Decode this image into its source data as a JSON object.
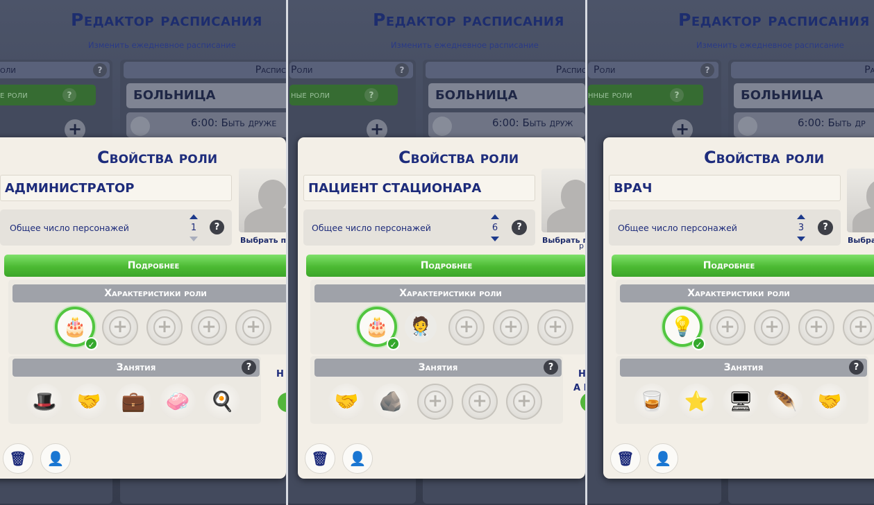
{
  "schedule_editor": {
    "title": "Редактор расписания",
    "subtitle": "Изменить ежедневное расписание",
    "roles_header": "Роли",
    "roles_header_partial": "оли",
    "schedule_header_partial": "Распис",
    "schedule_header_partial2": "Распис",
    "schedule_header_partial3": "Расп",
    "green_role_partial": "е роли",
    "green_role_partial2": "ные роли",
    "green_role_partial3": "нные роли",
    "venue": "БОЛЬНИЦА",
    "entry_partial": "6:00: Быть друже",
    "entry_partial2": "6:00: Быть друж",
    "entry_partial3": "6:00: Быть др",
    "help": "?",
    "add": "+"
  },
  "dialog_common": {
    "title": "Свойства роли",
    "count_label": "Общее число персонажей",
    "pick_label_1": "Выбрать пе",
    "pick_label_2": "Выбрать п",
    "pick_label_3": "Выбра",
    "details": "Подробнее",
    "traits_header": "Характеристики роли",
    "activities_header": "Занятия",
    "help": "?",
    "plus": "+",
    "check": "✓"
  },
  "roles": [
    {
      "name": "АДМИНИСТРАТОР",
      "count": "1",
      "trait_icon": "cake-icon",
      "activities": [
        "hat-icon",
        "handshake-icon",
        "briefcase-icon",
        "soap-icon",
        "frying-pan-icon"
      ],
      "side_text_1": "Н"
    },
    {
      "name": "ПАЦИЕНТ СТАЦИОНАРА",
      "count": "6",
      "trait_icon": "cake-icon",
      "extra_trait_icon": "doctor-portrait-icon",
      "activities": [
        "handshake-icon",
        "rock-icon"
      ],
      "side_text_1": "Н",
      "side_text_2": "А Р",
      "edge_1": "1",
      "edge_2": "р",
      "edge_3": "6"
    },
    {
      "name": "ВРАЧ",
      "count": "3",
      "trait_icon": "lightbulb-icon",
      "activities": [
        "drink-glass-icon",
        "star-icon",
        "computer-icon",
        "feather-duster-icon",
        "handshake-icon"
      ],
      "edge_1": "1"
    }
  ],
  "colors": {
    "accent_green": "#4cba33",
    "title_blue": "#1d2c7c"
  }
}
